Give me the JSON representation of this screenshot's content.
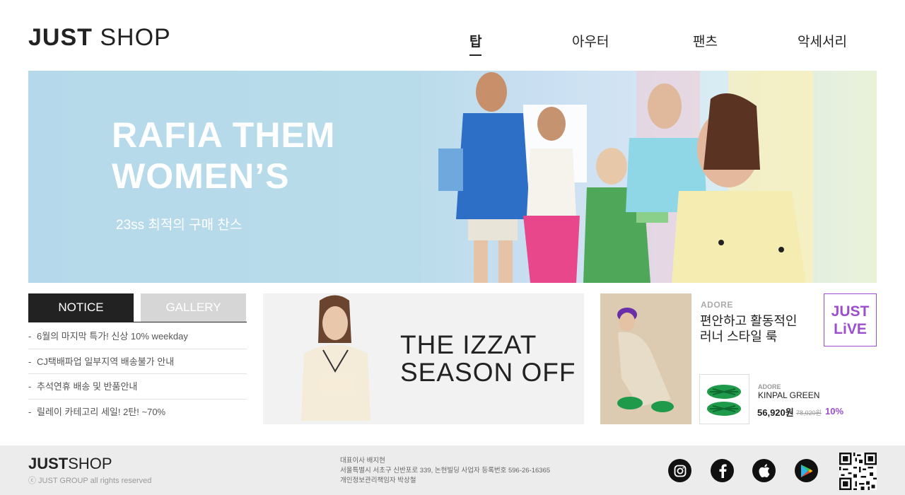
{
  "header": {
    "logo_bold": "JUST",
    "logo_light": "SHOP",
    "nav": [
      {
        "label": "탑",
        "active": true
      },
      {
        "label": "아우터",
        "active": false
      },
      {
        "label": "팬츠",
        "active": false
      },
      {
        "label": "악세서리",
        "active": false
      }
    ]
  },
  "hero": {
    "title": "RAFIA THEM\nWOMEN’S",
    "subtitle": "23ss 최적의 구매 찬스"
  },
  "notice": {
    "tabs": {
      "notice": "NOTICE",
      "gallery": "GALLERY"
    },
    "dash": "-",
    "items": [
      "6월의 마지막 특가! 신상 10% weekday",
      "CJ택배파업 일부지역 배송불가 안내",
      "추석연휴 배송 및 반품안내",
      "릴레이 카테고리 세일! 2탄! ~70%"
    ]
  },
  "mid_banner": {
    "line1": "THE IZZAT",
    "line2": "SEASON OFF"
  },
  "right_promo": {
    "brand": "ADORE",
    "headline": "편안하고 활동적인\n러너 스타일 룩",
    "live_badge": "JUST\nLiVE",
    "product": {
      "brand": "ADORE",
      "name": "KINPAL GREEN",
      "price": "56,920원",
      "original_price": "78,020원",
      "discount": "10%"
    }
  },
  "footer": {
    "logo_bold": "JUST",
    "logo_light": "SHOP",
    "copyright": "ⓒ JUST GROUP all rights reserved",
    "info": [
      "대표이사 배지현",
      "서울특별시 서초구 신반포로 339, 논현빌딩 사업자 등록번호 596-26-16365",
      "개인정보관리책임자 박상철"
    ],
    "social_icons": [
      "instagram-icon",
      "facebook-icon",
      "apple-icon",
      "google-play-icon"
    ]
  }
}
